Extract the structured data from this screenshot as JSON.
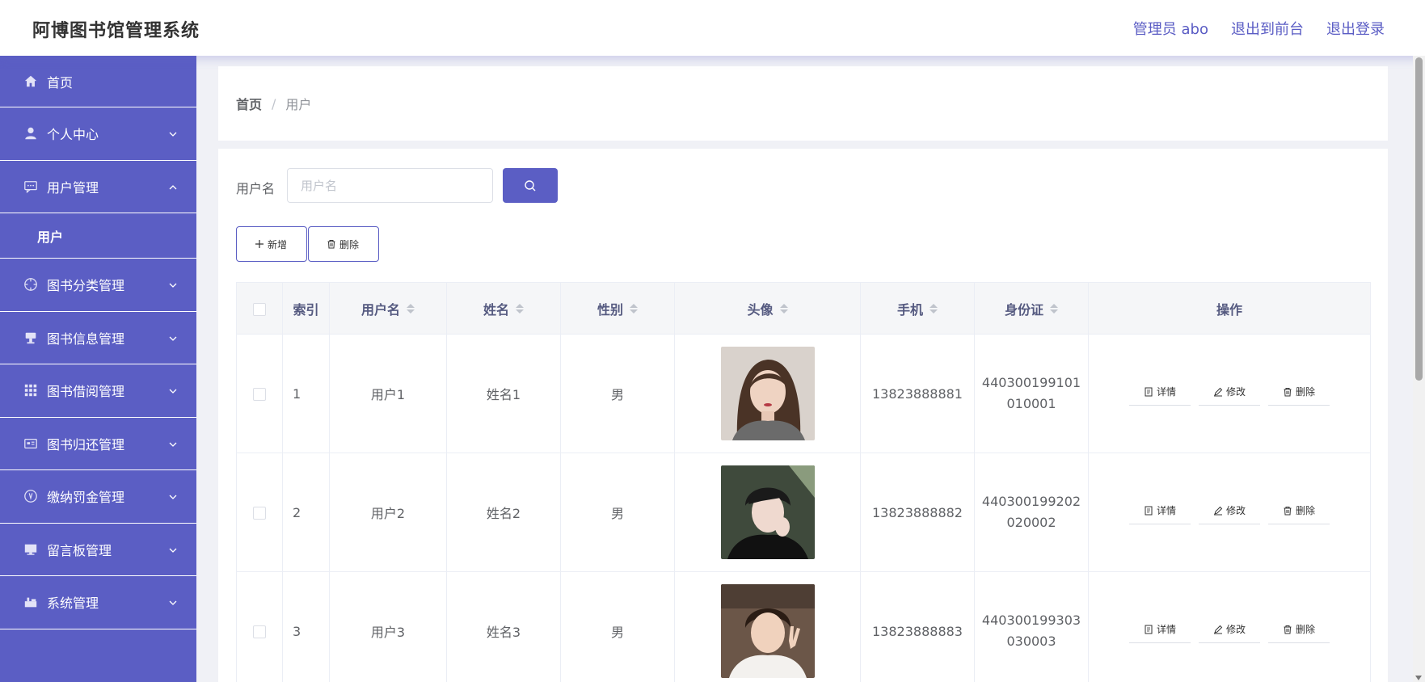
{
  "header": {
    "title": "阿博图书馆管理系统",
    "admin_label": "管理员 abo",
    "front_label": "退出到前台",
    "logout_label": "退出登录"
  },
  "sidebar": {
    "items": [
      {
        "label": "首页",
        "icon": "home-icon"
      },
      {
        "label": "个人中心",
        "icon": "user-icon"
      },
      {
        "label": "用户管理",
        "icon": "chat-icon",
        "expanded": true,
        "sub": [
          "用户"
        ]
      },
      {
        "label": "图书分类管理",
        "icon": "compass-icon"
      },
      {
        "label": "图书信息管理",
        "icon": "stamp-icon"
      },
      {
        "label": "图书借阅管理",
        "icon": "grid-icon"
      },
      {
        "label": "图书归还管理",
        "icon": "card-icon"
      },
      {
        "label": "缴纳罚金管理",
        "icon": "coin-icon"
      },
      {
        "label": "留言板管理",
        "icon": "monitor-icon"
      },
      {
        "label": "系统管理",
        "icon": "gear-box-icon"
      }
    ]
  },
  "breadcrumb": {
    "home": "首页",
    "separator": "/",
    "current": "用户"
  },
  "search": {
    "label": "用户名",
    "placeholder": "用户名"
  },
  "actions": {
    "add_label": "新增",
    "delete_label": "删除"
  },
  "table": {
    "headers": {
      "index": "索引",
      "username": "用户名",
      "name": "姓名",
      "gender": "性别",
      "avatar": "头像",
      "phone": "手机",
      "idcard": "身份证",
      "ops": "操作"
    },
    "rows": [
      {
        "index": "1",
        "username": "用户1",
        "name": "姓名1",
        "gender": "男",
        "phone": "13823888881",
        "idcard": "440300199101010001"
      },
      {
        "index": "2",
        "username": "用户2",
        "name": "姓名2",
        "gender": "男",
        "phone": "13823888882",
        "idcard": "440300199202020002"
      },
      {
        "index": "3",
        "username": "用户3",
        "name": "姓名3",
        "gender": "男",
        "phone": "13823888883",
        "idcard": "440300199303030003"
      }
    ],
    "op_labels": {
      "detail": "详情",
      "edit": "修改",
      "delete": "删除"
    }
  },
  "colors": {
    "primary": "#5b5ec4",
    "header_text": "#5a5cc4",
    "table_header_bg": "#f5f6f8"
  }
}
